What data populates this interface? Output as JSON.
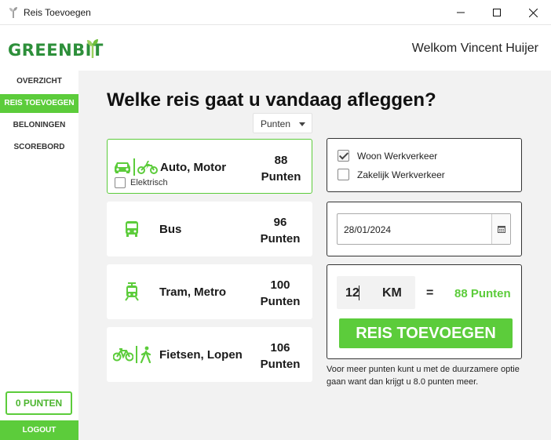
{
  "window": {
    "title": "Reis Toevoegen"
  },
  "header": {
    "logo_text": "GREENBIT",
    "welcome": "Welkom Vincent Huijer"
  },
  "sidebar": {
    "items": [
      {
        "label": "OVERZICHT",
        "active": false
      },
      {
        "label": "REIS TOEVOEGEN",
        "active": true
      },
      {
        "label": "BELONINGEN",
        "active": false
      },
      {
        "label": "SCOREBORD",
        "active": false
      }
    ],
    "points": "0 PUNTEN",
    "logout": "LOGOUT"
  },
  "main": {
    "heading": "Welke reis gaat u vandaag afleggen?",
    "sort_dropdown": {
      "selected": "Punten"
    },
    "transport_options": [
      {
        "label": "Auto, Motor",
        "points": "88",
        "unit": "Punten",
        "icons": [
          "car-icon",
          "electric-scooter-icon"
        ],
        "electric_label": "Elektrisch",
        "electric_checked": false,
        "selected": true
      },
      {
        "label": "Bus",
        "points": "96",
        "unit": "Punten",
        "icons": [
          "bus-icon"
        ],
        "selected": false
      },
      {
        "label": "Tram, Metro",
        "points": "100",
        "unit": "Punten",
        "icons": [
          "tram-icon"
        ],
        "selected": false
      },
      {
        "label": "Fietsen, Lopen",
        "points": "106",
        "unit": "Punten",
        "icons": [
          "bicycle-icon",
          "walking-icon"
        ],
        "selected": false
      }
    ],
    "travel_type": {
      "woon": {
        "label": "Woon Werkverkeer",
        "checked": true
      },
      "zakelijk": {
        "label": "Zakelijk Werkverkeer",
        "checked": false
      }
    },
    "date": {
      "value": "28/01/2024"
    },
    "distance": {
      "value": "12",
      "unit": "KM",
      "equals": "=",
      "result": "88 Punten"
    },
    "add_button": "REIS TOEVOEGEN",
    "hint": "Voor meer punten kunt u met de duurzamere optie gaan want dan krijgt u 8.0 punten meer."
  },
  "colors": {
    "accent": "#5ccc3b",
    "logo": "#2d8f3a",
    "background": "#f2f2f2"
  }
}
